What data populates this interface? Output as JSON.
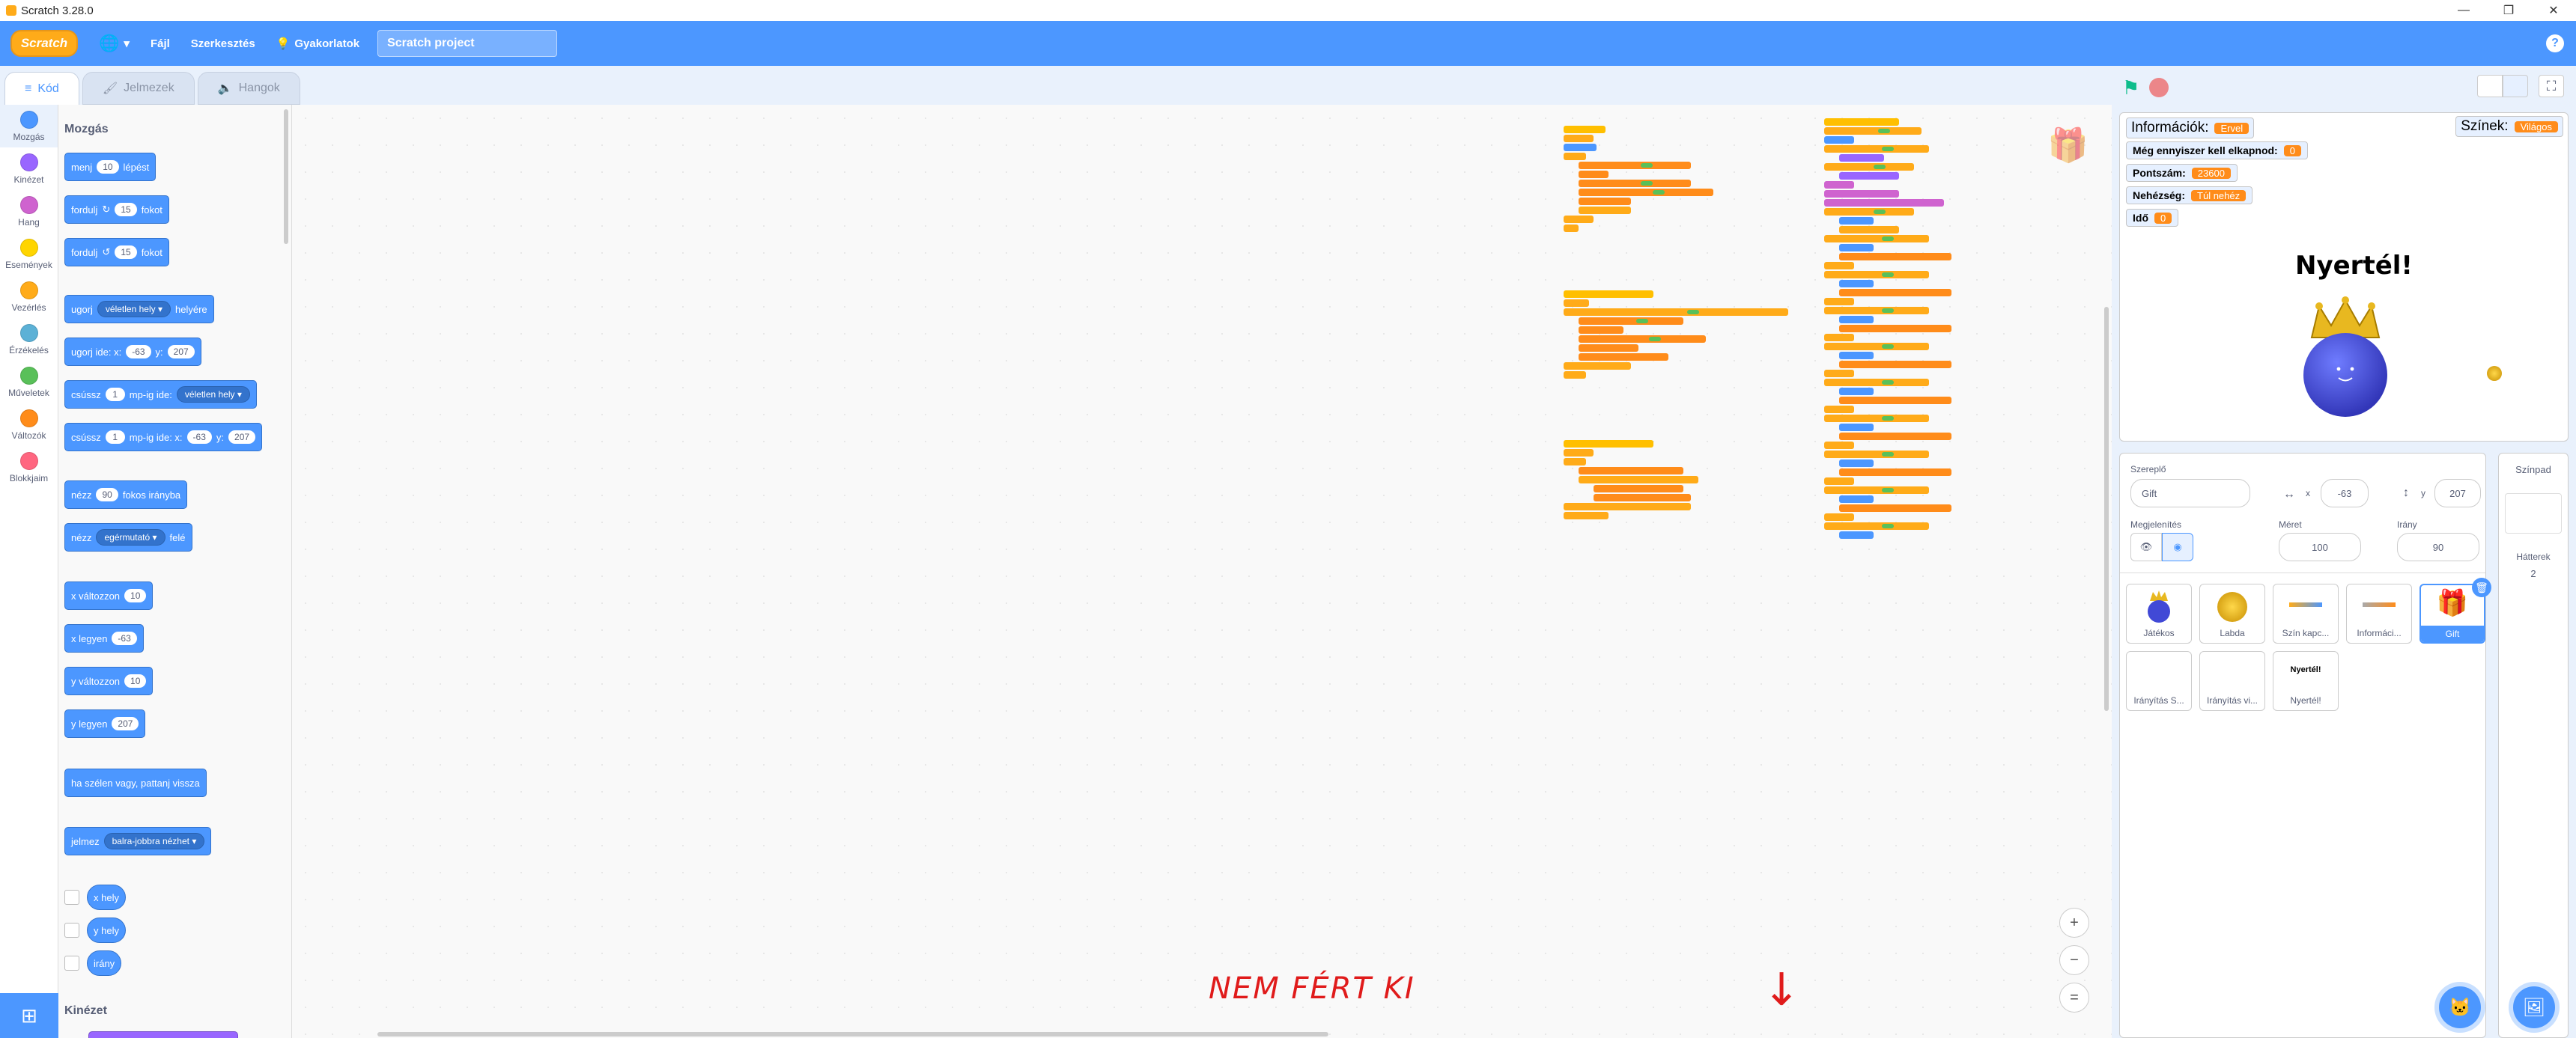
{
  "window": {
    "title": "Scratch 3.28.0",
    "min": "—",
    "max": "❐",
    "close": "✕"
  },
  "menu": {
    "logo": "Scratch",
    "file": "Fájl",
    "edit": "Szerkesztés",
    "tutorials": "Gyakorlatok",
    "project_title": "Scratch project",
    "help": "?"
  },
  "tabs": {
    "code": "Kód",
    "costumes": "Jelmezek",
    "sounds": "Hangok"
  },
  "categories": [
    {
      "label": "Mozgás",
      "color": "#4c97ff"
    },
    {
      "label": "Kinézet",
      "color": "#9966ff"
    },
    {
      "label": "Hang",
      "color": "#cf63cf"
    },
    {
      "label": "Események",
      "color": "#ffd500"
    },
    {
      "label": "Vezérlés",
      "color": "#ffab19"
    },
    {
      "label": "Érzékelés",
      "color": "#5cb1d6"
    },
    {
      "label": "Műveletek",
      "color": "#59c059"
    },
    {
      "label": "Változók",
      "color": "#ff8c1a"
    },
    {
      "label": "Blokkjaim",
      "color": "#ff6680"
    }
  ],
  "palette": {
    "heading_motion": "Mozgás",
    "heading_looks": "Kinézet",
    "b1": {
      "a": "menj",
      "v": "10",
      "b": "lépést"
    },
    "b2": {
      "a": "fordulj",
      "v": "15",
      "b": "fokot"
    },
    "b3": {
      "a": "fordulj",
      "v": "15",
      "b": "fokot"
    },
    "b4": {
      "a": "ugorj",
      "dd": "véletlen hely",
      "b": "helyére"
    },
    "b5": {
      "a": "ugorj ide: x:",
      "x": "-63",
      "y_lbl": "y:",
      "y": "207"
    },
    "b6": {
      "a": "csússz",
      "v": "1",
      "b": "mp-ig ide:",
      "dd": "véletlen hely"
    },
    "b7": {
      "a": "csússz",
      "v": "1",
      "b": "mp-ig ide: x:",
      "x": "-63",
      "y_lbl": "y:",
      "y": "207"
    },
    "b8": {
      "a": "nézz",
      "v": "90",
      "b": "fokos irányba"
    },
    "b9": {
      "a": "nézz",
      "dd": "egérmutató",
      "b": "felé"
    },
    "b10": {
      "a": "x változzon",
      "v": "10"
    },
    "b11": {
      "a": "x legyen",
      "v": "-63"
    },
    "b12": {
      "a": "y változzon",
      "v": "10"
    },
    "b13": {
      "a": "y legyen",
      "v": "207"
    },
    "b14": {
      "a": "ha szélen vagy, pattanj vissza"
    },
    "b15": {
      "a": "jelmez",
      "dd": "balra-jobbra nézhet"
    },
    "r1": "x hely",
    "r2": "y hely",
    "r3": "irány"
  },
  "annotation": "NEM FÉRT KI",
  "arrow": "↓",
  "zoom": {
    "in": "+",
    "out": "−",
    "reset": "="
  },
  "stage": {
    "monitors": {
      "info": {
        "label": "Információk:",
        "value": "Ervel"
      },
      "colors": {
        "label": "Színek:",
        "value": "Világos"
      },
      "remaining": {
        "label": "Még ennyiszer kell elkapnod:",
        "value": "0"
      },
      "score": {
        "label": "Pontszám:",
        "value": "23600"
      },
      "difficulty": {
        "label": "Nehézség:",
        "value": "Túl nehéz"
      },
      "time": {
        "label": "Idő",
        "value": "0"
      }
    },
    "win_text": "Nyertél!"
  },
  "sprite_info": {
    "sprite_label": "Szereplő",
    "sprite_name": "Gift",
    "x_label": "x",
    "x": "-63",
    "y_label": "y",
    "y": "207",
    "show_label": "Megjelenítés",
    "size_label": "Méret",
    "size": "100",
    "dir_label": "Irány",
    "direction": "90"
  },
  "sprites": [
    "Játékos",
    "Labda",
    "Szín kapc...",
    "Informáci...",
    "Gift",
    "Irányítás S...",
    "Irányítás vi...",
    "Nyertél!"
  ],
  "nyertel_thumb": "Nyertél!",
  "backdrop": {
    "title": "Színpad",
    "label": "Hátterek",
    "count": "2"
  }
}
